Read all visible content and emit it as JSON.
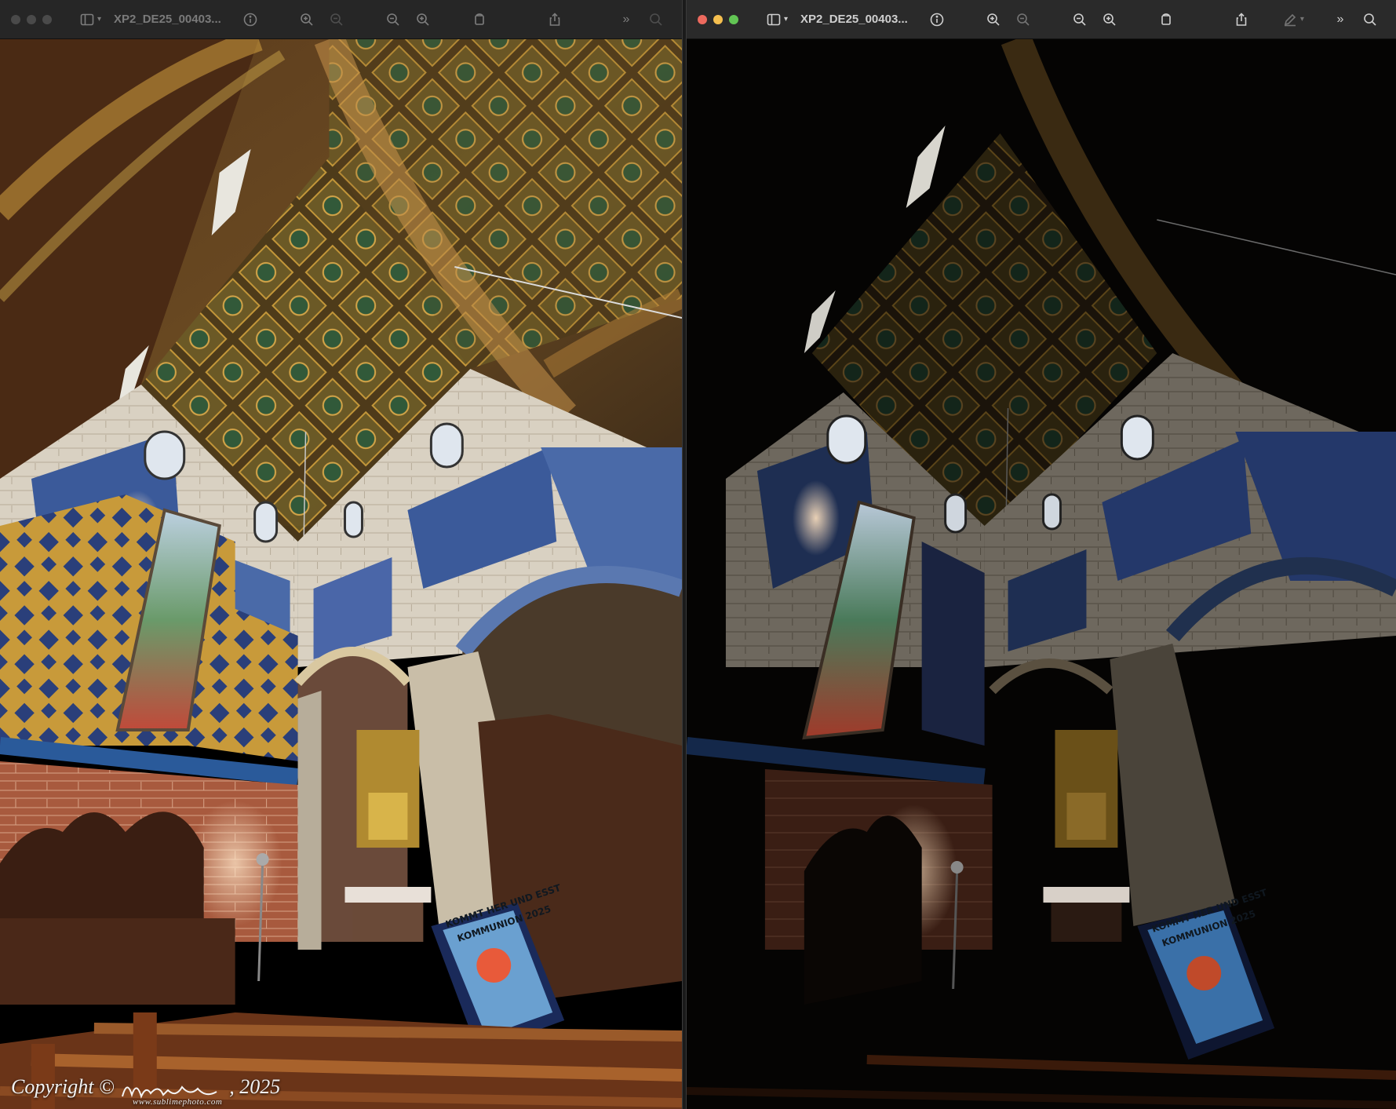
{
  "windows": [
    {
      "id": "left",
      "title": "XP2_DE25_00403...",
      "active": false,
      "icons": [
        "sidebar-icon",
        "info-icon",
        "zoom-in-icon",
        "zoom-out-icon",
        "zoom-out-icon",
        "zoom-in-icon",
        "rotate-icon",
        "share-icon",
        "more-icon",
        "search-icon"
      ]
    },
    {
      "id": "right",
      "title": "XP2_DE25_00403...",
      "active": true,
      "icons": [
        "sidebar-icon",
        "info-icon",
        "zoom-in-icon",
        "zoom-out-icon",
        "zoom-out-icon",
        "zoom-in-icon",
        "rotate-icon",
        "share-icon",
        "markup-icon",
        "more-icon",
        "search-icon"
      ]
    }
  ],
  "watermark": {
    "text": "Copyright ©",
    "year": ", 2025",
    "url": "www.sublimephoto.com"
  },
  "banner": {
    "line1": "KOMMT HER UND ESST",
    "line2": "KOMMUNION 2025"
  },
  "colors": {
    "titlebar": "#2a2a2a",
    "close": "#ed6a5e",
    "minimize": "#f5bf4f",
    "zoom": "#62c554"
  }
}
